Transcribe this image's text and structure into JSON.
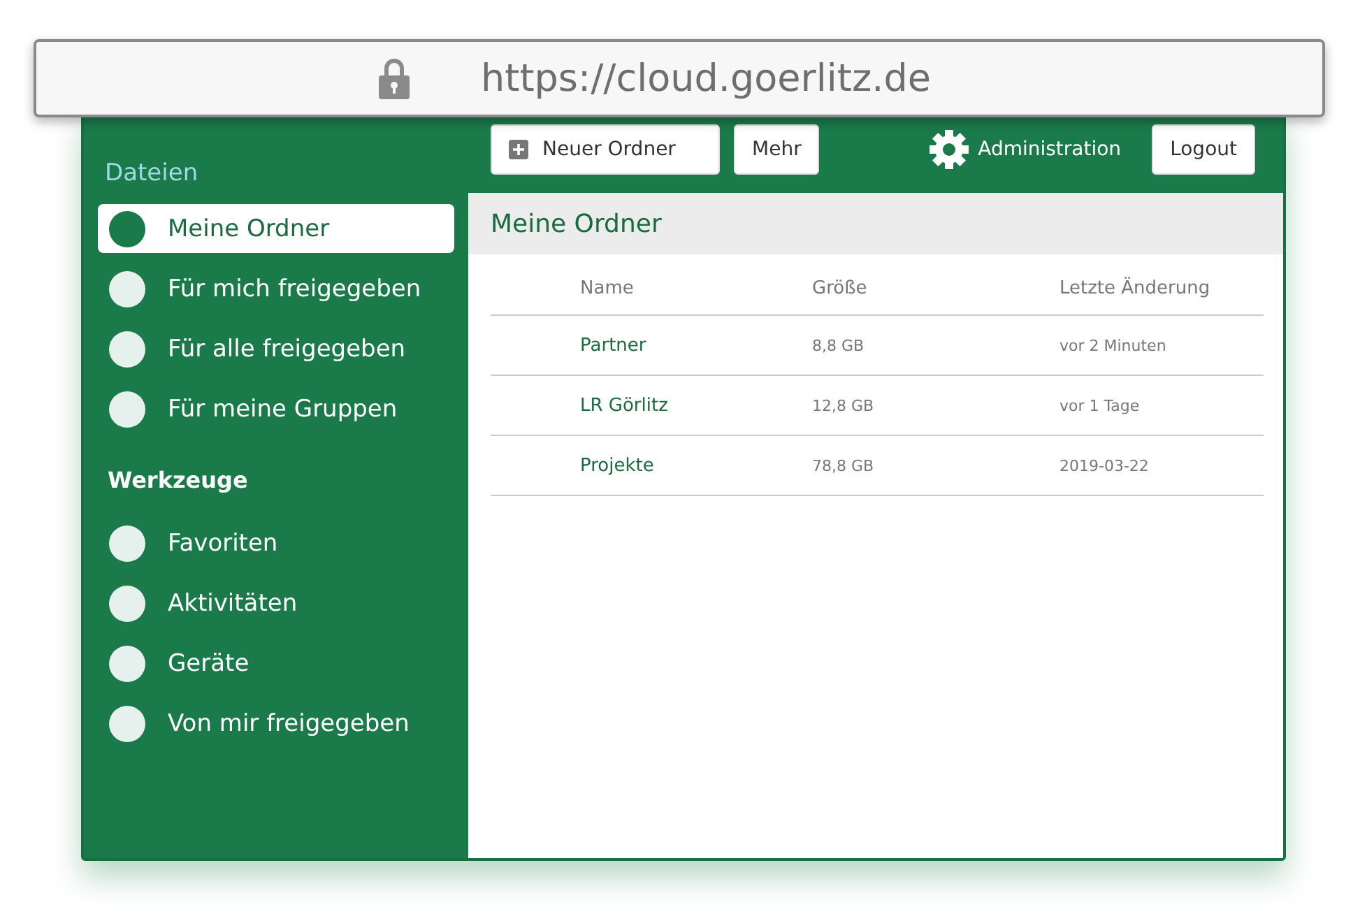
{
  "address_bar": {
    "url": "https://cloud.goerlitz.de"
  },
  "sidebar": {
    "sections": [
      {
        "title": "Dateien",
        "kind": "files",
        "items": [
          {
            "label": "Meine Ordner",
            "selected": true
          },
          {
            "label": "Für mich freigegeben",
            "selected": false
          },
          {
            "label": "Für alle freigegeben",
            "selected": false
          },
          {
            "label": "Für meine Gruppen",
            "selected": false
          }
        ]
      },
      {
        "title": "Werkzeuge",
        "kind": "tools",
        "items": [
          {
            "label": "Favoriten",
            "selected": false
          },
          {
            "label": "Aktivitäten",
            "selected": false
          },
          {
            "label": "Geräte",
            "selected": false
          },
          {
            "label": "Von mir freigegeben",
            "selected": false
          }
        ]
      }
    ]
  },
  "toolbar": {
    "new_folder": "Neuer Ordner",
    "more": "Mehr",
    "admin": "Administration",
    "logout": "Logout"
  },
  "content": {
    "title": "Meine Ordner",
    "table": {
      "columns": [
        "Name",
        "Größe",
        "Letzte Änderung"
      ],
      "rows": [
        {
          "name": "Partner",
          "size": "8,8 GB",
          "modified": "vor 2 Minuten"
        },
        {
          "name": "LR Görlitz",
          "size": "12,8 GB",
          "modified": "vor 1 Tage"
        },
        {
          "name": "Projekte",
          "size": "78,8 GB",
          "modified": "2019-03-22"
        }
      ]
    }
  }
}
